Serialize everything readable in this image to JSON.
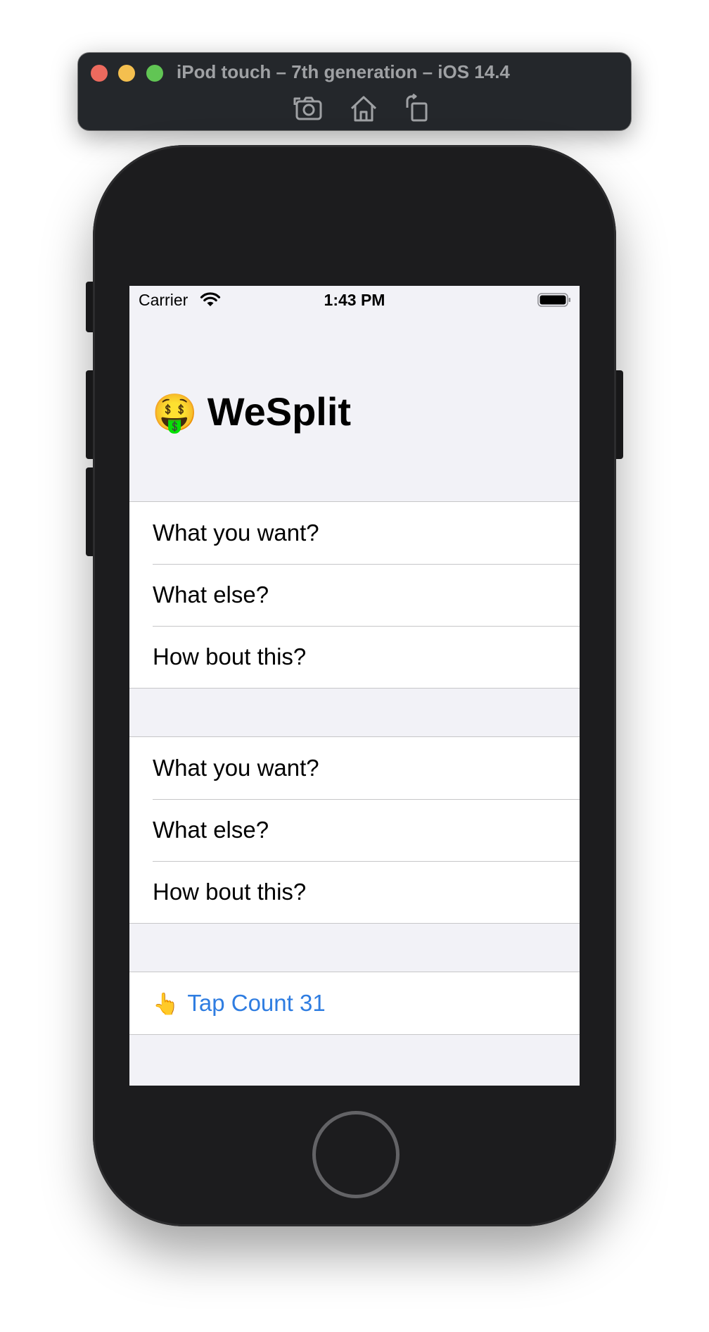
{
  "simulator": {
    "title": "iPod touch – 7th generation – iOS 14.4",
    "tools": [
      "screenshot-icon",
      "home-icon",
      "rotate-icon"
    ]
  },
  "status_bar": {
    "carrier": "Carrier",
    "time": "1:43 PM"
  },
  "navigation": {
    "title_emoji": "🤑",
    "title": "WeSplit"
  },
  "sections": [
    {
      "rows": [
        "What you want?",
        "What else?",
        "How bout this?"
      ]
    },
    {
      "rows": [
        "What you want?",
        "What else?",
        "How bout this?"
      ]
    },
    {
      "button": {
        "emoji": "👆",
        "label": "Tap Count 31"
      }
    }
  ],
  "colors": {
    "accent": "#2f7de1",
    "grouped_background": "#f2f2f7",
    "separator": "#c6c6c8",
    "device": "#1c1c1e"
  }
}
